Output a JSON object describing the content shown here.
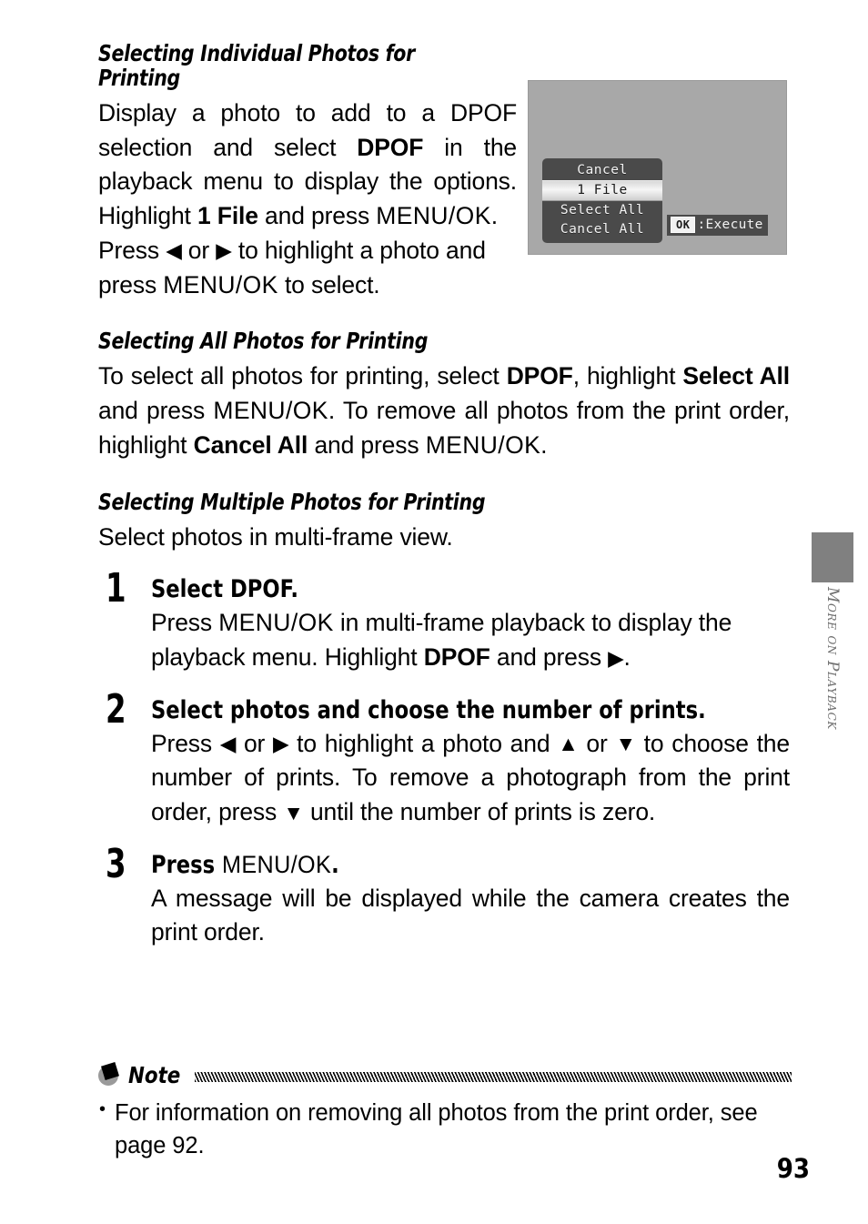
{
  "page": {
    "number": "93",
    "side_tab_label": "More on Playback"
  },
  "section1": {
    "heading": "Selecting Individual Photos for Printing",
    "para1_a": "Display a photo to add to a DPOF selection and select ",
    "para1_dpof": "DPOF",
    "para1_b": " in the playback menu to display the options. Highlight ",
    "para1_onefile": "1 File",
    "para1_c": " and press ",
    "para1_menuok": "MENU/OK",
    "para1_d": ".",
    "para2_a": "Press ",
    "para2_left": "◀",
    "para2_b": " or ",
    "para2_right": "▶",
    "para2_c": " to highlight a photo and press ",
    "para2_menuok": "MENU/OK",
    "para2_d": " to select."
  },
  "lcd": {
    "items": [
      {
        "label": "Cancel",
        "selected": false
      },
      {
        "label": "1 File",
        "selected": true
      },
      {
        "label": "Select All",
        "selected": false
      },
      {
        "label": "Cancel All",
        "selected": false
      }
    ],
    "badge_key": "OK",
    "badge_action": ":Execute",
    "background_color": "#a8a8a8",
    "menu_color": "#4a4a4a"
  },
  "section2": {
    "heading": "Selecting All Photos for Printing",
    "a": "To select all photos for printing, select ",
    "dpof": "DPOF",
    "b": ", highlight ",
    "select_all": "Select All",
    "c": " and press ",
    "menuok1": "MENU/OK",
    "d": ". To remove all photos from the print order, highlight ",
    "cancel_all": "Cancel All",
    "e": " and press ",
    "menuok2": "MENU/OK",
    "f": "."
  },
  "section3": {
    "heading": "Selecting Multiple Photos for Printing",
    "intro": "Select photos in multi-frame view.",
    "steps": [
      {
        "number": "1",
        "title_a": "Select ",
        "title_b": "DPOF",
        "title_c": ".",
        "body_a": "Press ",
        "body_menuok": "MENU/OK",
        "body_b": " in multi-frame playback to display the playback menu. Highlight ",
        "body_dpof": "DPOF",
        "body_c": " and press ",
        "body_arrow": "▶",
        "body_d": "."
      },
      {
        "number": "2",
        "title_a": "Select photos and choose the number of prints.",
        "title_b": "",
        "title_c": "",
        "body_a": "Press ",
        "body_left": "◀",
        "body_b": " or ",
        "body_right": "▶",
        "body_c": " to highlight a photo and ",
        "body_up": "▲",
        "body_d": " or ",
        "body_down": "▼",
        "body_e": " to choose the number of prints. To remove a photograph from the print order, press ",
        "body_down2": "▼",
        "body_f": " until the number of prints is zero."
      },
      {
        "number": "3",
        "title_a": "Press ",
        "title_menuok": "MENU/OK",
        "title_c": ".",
        "body_a": "A message will be displayed while the camera creates the print order."
      }
    ]
  },
  "note": {
    "title": "Note",
    "items": [
      "For information on removing all photos from the print order, see page 92."
    ]
  }
}
